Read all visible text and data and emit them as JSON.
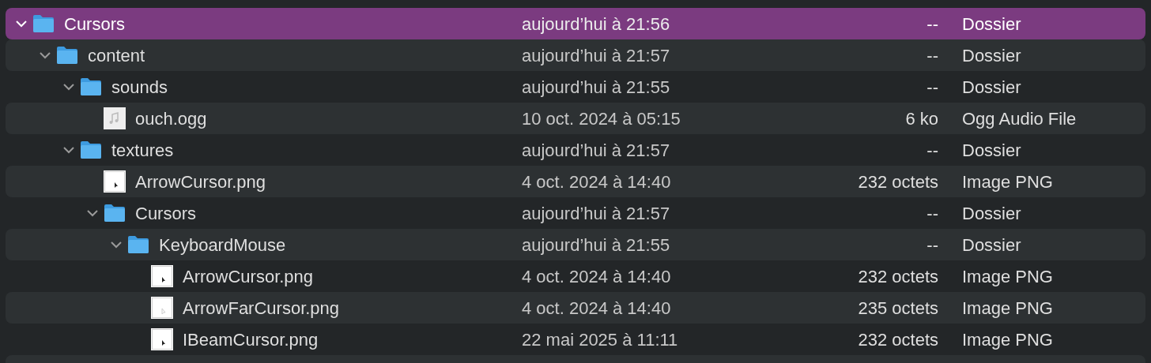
{
  "rows": [
    {
      "name": "Cursors",
      "date": "aujourd’hui à 21:56",
      "size": "--",
      "file_type": "Dossier",
      "kind": "folder",
      "expanded": true,
      "selected": true,
      "children": [
        {
          "name": "content",
          "date": "aujourd’hui à 21:57",
          "size": "--",
          "file_type": "Dossier",
          "kind": "folder",
          "expanded": true,
          "selected": false,
          "children": [
            {
              "name": "sounds",
              "date": "aujourd’hui à 21:55",
              "size": "--",
              "file_type": "Dossier",
              "kind": "folder",
              "expanded": true,
              "selected": false,
              "children": [
                {
                  "name": "ouch.ogg",
                  "date": "10 oct. 2024 à 05:15",
                  "size": "6 ko",
                  "file_type": "Ogg Audio File",
                  "kind": "audio",
                  "selected": false
                }
              ]
            },
            {
              "name": "textures",
              "date": "aujourd’hui à 21:57",
              "size": "--",
              "file_type": "Dossier",
              "kind": "folder",
              "expanded": true,
              "selected": false,
              "children": [
                {
                  "name": "ArrowCursor.png",
                  "date": "4 oct. 2024 à 14:40",
                  "size": "232 octets",
                  "file_type": "Image PNG",
                  "kind": "image",
                  "selected": false
                },
                {
                  "name": "Cursors",
                  "date": "aujourd’hui à 21:57",
                  "size": "--",
                  "file_type": "Dossier",
                  "kind": "folder",
                  "expanded": true,
                  "selected": false,
                  "children": [
                    {
                      "name": "KeyboardMouse",
                      "date": "aujourd’hui à 21:55",
                      "size": "--",
                      "file_type": "Dossier",
                      "kind": "folder",
                      "expanded": true,
                      "selected": false,
                      "children": [
                        {
                          "name": "ArrowCursor.png",
                          "date": "4 oct. 2024 à 14:40",
                          "size": "232 octets",
                          "file_type": "Image PNG",
                          "kind": "image",
                          "selected": false
                        },
                        {
                          "name": "ArrowFarCursor.png",
                          "date": "4 oct. 2024 à 14:40",
                          "size": "235 octets",
                          "file_type": "Image PNG",
                          "kind": "faint",
                          "selected": false
                        },
                        {
                          "name": "IBeamCursor.png",
                          "date": "22 mai 2025 à 11:11",
                          "size": "232 octets",
                          "file_type": "Image PNG",
                          "kind": "image",
                          "selected": false
                        }
                      ]
                    }
                  ]
                }
              ]
            }
          ]
        }
      ]
    }
  ]
}
